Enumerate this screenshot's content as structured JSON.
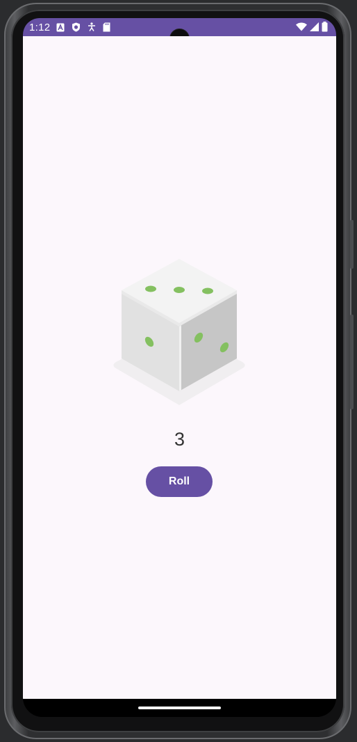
{
  "status_bar": {
    "time": "1:12",
    "left_icons": [
      "font-a-icon",
      "shield-play-icon",
      "accessibility-icon",
      "sd-card-icon"
    ],
    "right_icons": [
      "wifi-icon",
      "cell-signal-icon",
      "battery-icon"
    ],
    "background_color": "#6650a4"
  },
  "dice": {
    "value": 3,
    "pip_color": "#84c060"
  },
  "result": {
    "text": "3"
  },
  "roll_button": {
    "label": "Roll",
    "color": "#6650a4"
  },
  "colors": {
    "app_background": "#fcf7fc",
    "accent": "#6650a4"
  }
}
